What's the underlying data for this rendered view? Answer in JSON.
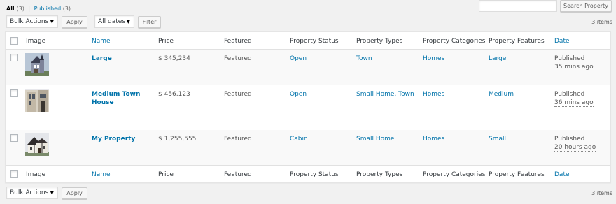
{
  "views": {
    "all_label": "All",
    "all_count": "(3)",
    "separator": "|",
    "published_label": "Published",
    "published_count": "(3)"
  },
  "search": {
    "value": "",
    "button_label": "Search Property"
  },
  "top_nav": {
    "bulk_actions": "Bulk Actions",
    "apply_label": "Apply",
    "dates_filter": "All dates",
    "filter_label": "Filter",
    "items_count": "3 items"
  },
  "bottom_nav": {
    "bulk_actions": "Bulk Actions",
    "apply_label": "Apply",
    "items_count": "3 items"
  },
  "columns": {
    "image": "Image",
    "name": "Name",
    "price": "Price",
    "featured": "Featured",
    "status": "Property Status",
    "types": "Property Types",
    "categories": "Property Categories",
    "features": "Property Features",
    "date": "Date"
  },
  "rows": [
    {
      "name": "Large",
      "price": "$ 345,234",
      "featured": "Featured",
      "status": "Open",
      "types": "Town",
      "categories": "Homes",
      "features": "Large",
      "date_status": "Published",
      "date_ago": "35 mins ago",
      "thumb": "victorian-house-image"
    },
    {
      "name": "Medium Town House",
      "price": "$ 456,123",
      "featured": "Featured",
      "status": "Open",
      "types": "Small Home, Town",
      "categories": "Homes",
      "features": "Medium",
      "date_status": "Published",
      "date_ago": "36 mins ago",
      "thumb": "townhouse-image"
    },
    {
      "name": "My Property",
      "price": "$ 1,255,555",
      "featured": "Featured",
      "status": "Cabin",
      "types": "Small Home",
      "categories": "Homes",
      "features": "Small",
      "date_status": "Published",
      "date_ago": "20 hours ago",
      "thumb": "tudor-house-image"
    }
  ],
  "colors": {
    "link": "#0073aa",
    "background": "#f1f1f1",
    "row_alt": "#f9f9f9"
  }
}
